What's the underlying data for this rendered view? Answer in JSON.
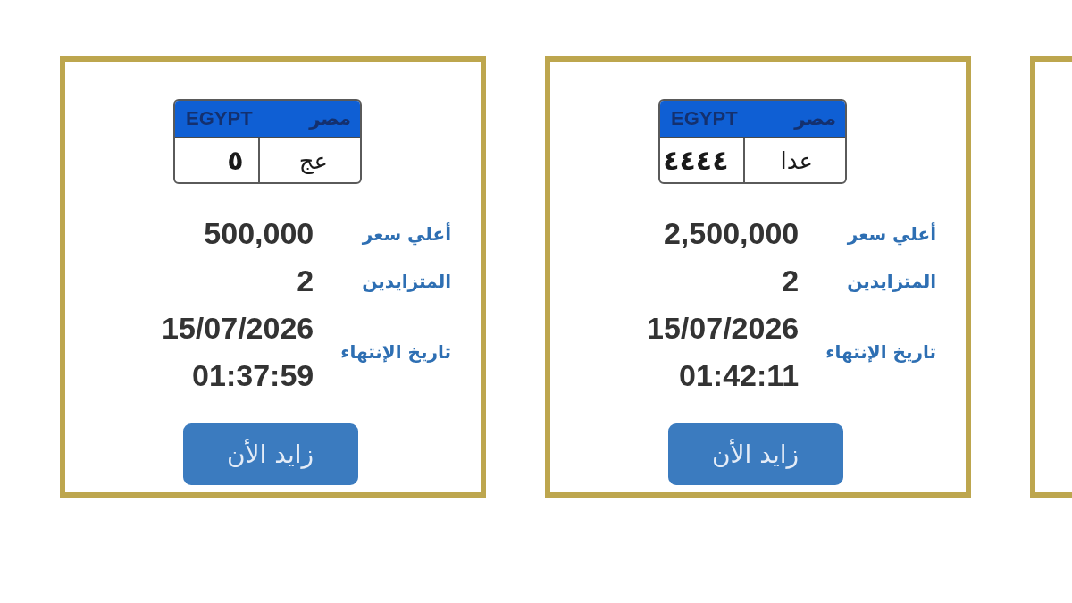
{
  "cards": [
    {
      "kind": "cut_off"
    },
    {
      "kind": "full",
      "plate": {
        "country_en": "EGYPT",
        "country_ar": "مصر",
        "number": "٤٤٤٤",
        "letters": "عدا"
      },
      "fields": [
        {
          "label": "أعلي سعر",
          "value": "2,500,000"
        },
        {
          "label": "المتزايدين",
          "value": "2"
        },
        {
          "label": "تاريخ الإنتهاء",
          "value": "15/07/2026 01:42:11"
        }
      ],
      "button": "زايد الأن"
    },
    {
      "kind": "full",
      "plate": {
        "country_en": "EGYPT",
        "country_ar": "مصر",
        "number": "٥",
        "letters": "عج"
      },
      "fields": [
        {
          "label": "أعلي سعر",
          "value": "500,000"
        },
        {
          "label": "المتزايدين",
          "value": "2"
        },
        {
          "label": "تاريخ الإنتهاء",
          "value": "15/07/2026 01:37:59"
        }
      ],
      "button": "زايد الأن"
    }
  ]
}
